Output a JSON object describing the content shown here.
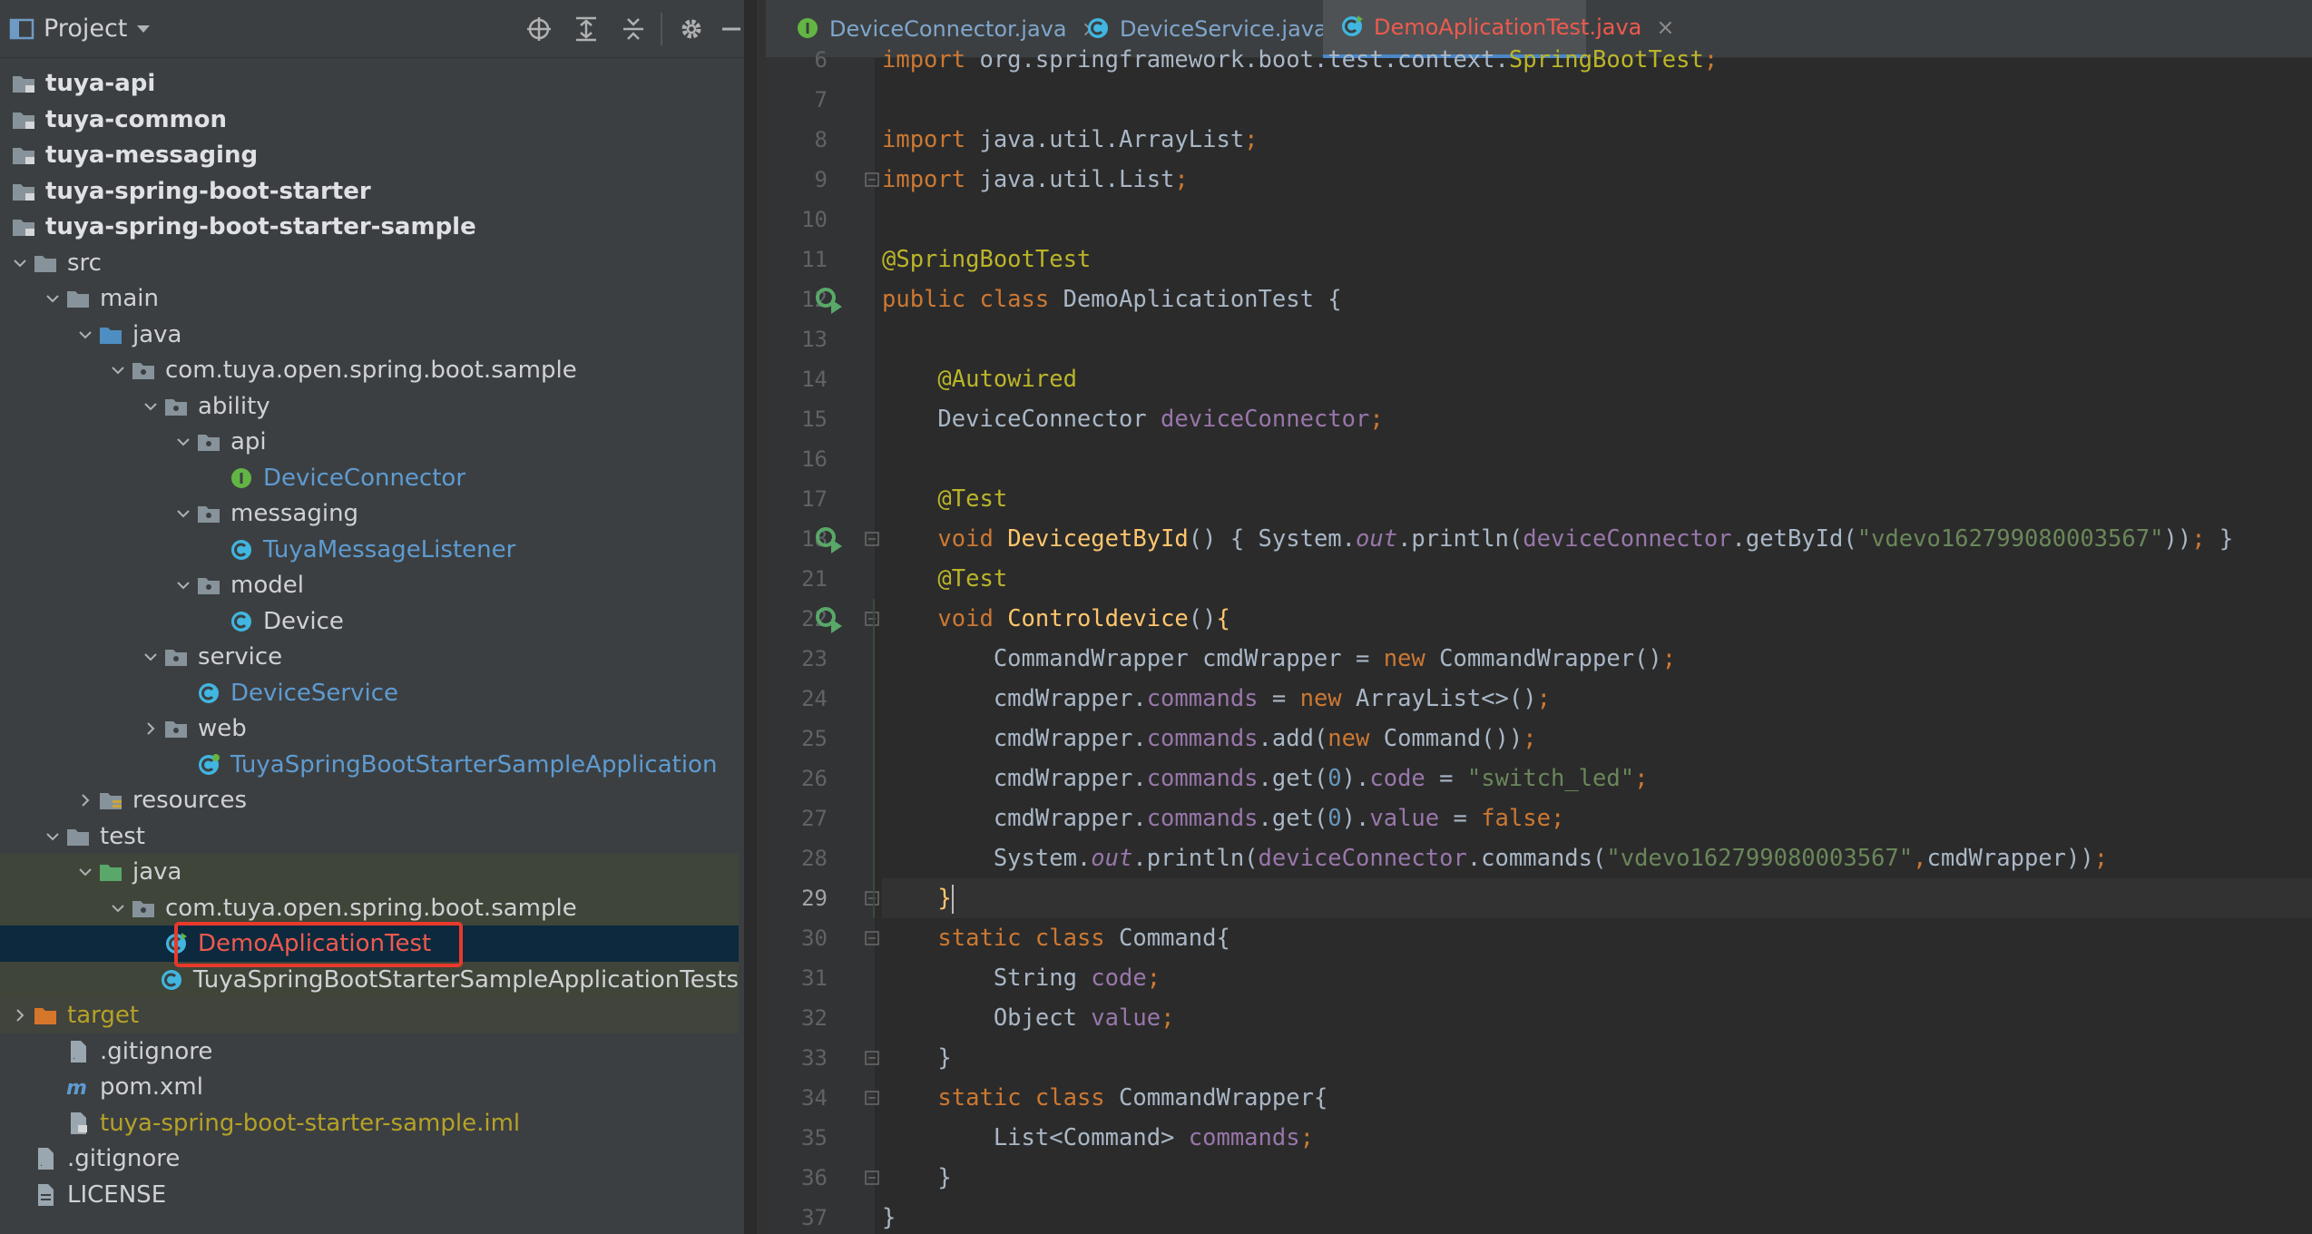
{
  "project_header": {
    "title": "Project",
    "icons": [
      "locate-icon",
      "expand-all-icon",
      "collapse-all-icon",
      "gear-icon",
      "hide-icon"
    ]
  },
  "tree": [
    {
      "label": "tuya-api",
      "icon": "module-folder-icon",
      "style": "bold",
      "expanded": null
    },
    {
      "label": "tuya-common",
      "icon": "module-folder-icon",
      "style": "bold",
      "expanded": null
    },
    {
      "label": "tuya-messaging",
      "icon": "module-folder-icon",
      "style": "bold",
      "expanded": null
    },
    {
      "label": "tuya-spring-boot-starter",
      "icon": "module-folder-icon",
      "style": "bold",
      "expanded": null
    },
    {
      "label": "tuya-spring-boot-starter-sample",
      "icon": "module-folder-icon",
      "style": "bold",
      "expanded": null
    },
    {
      "label": "src",
      "icon": "folder-icon",
      "style": "normal",
      "expanded": true
    },
    {
      "label": "main",
      "icon": "folder-icon",
      "style": "normal",
      "expanded": true
    },
    {
      "label": "java",
      "icon": "source-folder-icon",
      "style": "normal",
      "expanded": true
    },
    {
      "label": "com.tuya.open.spring.boot.sample",
      "icon": "package-icon",
      "style": "normal",
      "expanded": true
    },
    {
      "label": "ability",
      "icon": "package-icon",
      "style": "normal",
      "expanded": true
    },
    {
      "label": "api",
      "icon": "package-icon",
      "style": "normal",
      "expanded": true
    },
    {
      "label": "DeviceConnector",
      "icon": "interface-icon",
      "style": "blue",
      "expanded": null
    },
    {
      "label": "messaging",
      "icon": "package-icon",
      "style": "normal",
      "expanded": true
    },
    {
      "label": "TuyaMessageListener",
      "icon": "class-icon",
      "style": "blue",
      "expanded": null
    },
    {
      "label": "model",
      "icon": "package-icon",
      "style": "normal",
      "expanded": true
    },
    {
      "label": "Device",
      "icon": "class-icon",
      "style": "normal",
      "expanded": null
    },
    {
      "label": "service",
      "icon": "package-icon",
      "style": "normal",
      "expanded": true
    },
    {
      "label": "DeviceService",
      "icon": "class-icon",
      "style": "blue",
      "expanded": null
    },
    {
      "label": "web",
      "icon": "package-icon",
      "style": "normal",
      "expanded": false
    },
    {
      "label": "TuyaSpringBootStarterSampleApplication",
      "icon": "spring-class-icon",
      "style": "blue",
      "expanded": null
    },
    {
      "label": "resources",
      "icon": "resources-folder-icon",
      "style": "normal",
      "expanded": false
    },
    {
      "label": "test",
      "icon": "folder-icon",
      "style": "normal",
      "expanded": true
    },
    {
      "label": "java",
      "icon": "test-source-folder-icon",
      "style": "normal",
      "expanded": true
    },
    {
      "label": "com.tuya.open.spring.boot.sample",
      "icon": "package-icon",
      "style": "normal",
      "expanded": true
    },
    {
      "label": "DemoAplicationTest",
      "icon": "test-class-icon",
      "style": "red",
      "expanded": null
    },
    {
      "label": "TuyaSpringBootStarterSampleApplicationTests",
      "icon": "class-icon",
      "style": "normal",
      "expanded": null
    },
    {
      "label": "target",
      "icon": "excluded-folder-icon",
      "style": "olive",
      "expanded": false
    },
    {
      "label": ".gitignore",
      "icon": "file-icon",
      "style": "normal",
      "expanded": null
    },
    {
      "label": "pom.xml",
      "icon": "maven-icon",
      "style": "normal",
      "expanded": null
    },
    {
      "label": "tuya-spring-boot-starter-sample.iml",
      "icon": "iml-icon",
      "style": "olive",
      "expanded": null
    },
    {
      "label": ".gitignore",
      "icon": "file-icon",
      "style": "normal",
      "expanded": null
    },
    {
      "label": "LICENSE",
      "icon": "text-file-icon",
      "style": "normal",
      "expanded": null
    }
  ],
  "tabs": [
    {
      "label": "DeviceConnector.java",
      "icon": "interface-icon",
      "active": false
    },
    {
      "label": "DeviceService.java",
      "icon": "class-icon",
      "active": false
    },
    {
      "label": "DemoAplicationTest.java",
      "icon": "test-class-icon",
      "active": true
    }
  ],
  "tab_close_glyph": "×",
  "code_lines": [
    {
      "n": "6",
      "tokens": [
        [
          "kw",
          "import"
        ],
        [
          "dim",
          " org.springframework.boot.test.context."
        ],
        [
          "ann",
          "SpringBootTest"
        ],
        [
          "kw",
          ";"
        ]
      ]
    },
    {
      "n": "7",
      "tokens": []
    },
    {
      "n": "8",
      "tokens": [
        [
          "kw",
          "import"
        ],
        [
          "dim",
          " java.util.ArrayList"
        ],
        [
          "kw",
          ";"
        ]
      ]
    },
    {
      "n": "9",
      "tokens": [
        [
          "kw",
          "import"
        ],
        [
          "dim",
          " java.util.List"
        ],
        [
          "kw",
          ";"
        ]
      ]
    },
    {
      "n": "10",
      "tokens": []
    },
    {
      "n": "11",
      "tokens": [
        [
          "ann",
          "@SpringBootTest"
        ]
      ]
    },
    {
      "n": "12",
      "tokens": [
        [
          "kw",
          "public class "
        ],
        [
          "dim",
          "DemoAplicationTest {"
        ]
      ]
    },
    {
      "n": "13",
      "tokens": []
    },
    {
      "n": "14",
      "tokens": [
        [
          "dim",
          "    "
        ],
        [
          "ann",
          "@Autowired"
        ]
      ]
    },
    {
      "n": "15",
      "tokens": [
        [
          "dim",
          "    DeviceConnector "
        ],
        [
          "fld",
          "deviceConnector"
        ],
        [
          "kw",
          ";"
        ]
      ]
    },
    {
      "n": "16",
      "tokens": []
    },
    {
      "n": "17",
      "tokens": [
        [
          "dim",
          "    "
        ],
        [
          "ann",
          "@Test"
        ]
      ]
    },
    {
      "n": "18",
      "tokens": [
        [
          "dim",
          "    "
        ],
        [
          "kw",
          "void "
        ],
        [
          "fn",
          "DevicegetById"
        ],
        [
          "dim",
          "() { System."
        ],
        [
          "ital",
          "out"
        ],
        [
          "dim",
          ".println("
        ],
        [
          "fld",
          "deviceConnector"
        ],
        [
          "dim",
          ".getById("
        ],
        [
          "str",
          "\"vdevo162799080003567\""
        ],
        [
          "dim",
          "))"
        ],
        [
          "kw",
          ";"
        ],
        [
          "dim",
          " }"
        ]
      ]
    },
    {
      "n": "21",
      "tokens": [
        [
          "dim",
          "    "
        ],
        [
          "ann",
          "@Test"
        ]
      ]
    },
    {
      "n": "22",
      "tokens": [
        [
          "dim",
          "    "
        ],
        [
          "kw",
          "void "
        ],
        [
          "fn",
          "Controldevice"
        ],
        [
          "dim",
          "()"
        ],
        [
          "fn",
          "{"
        ]
      ]
    },
    {
      "n": "23",
      "tokens": [
        [
          "dim",
          "        CommandWrapper cmdWrapper = "
        ],
        [
          "kw",
          "new "
        ],
        [
          "dim",
          "CommandWrapper()"
        ],
        [
          "kw",
          ";"
        ]
      ]
    },
    {
      "n": "24",
      "tokens": [
        [
          "dim",
          "        cmdWrapper."
        ],
        [
          "fld",
          "commands"
        ],
        [
          "dim",
          " = "
        ],
        [
          "kw",
          "new "
        ],
        [
          "dim",
          "ArrayList<>()"
        ],
        [
          "kw",
          ";"
        ]
      ]
    },
    {
      "n": "25",
      "tokens": [
        [
          "dim",
          "        cmdWrapper."
        ],
        [
          "fld",
          "commands"
        ],
        [
          "dim",
          ".add("
        ],
        [
          "kw",
          "new "
        ],
        [
          "dim",
          "Command())"
        ],
        [
          "kw",
          ";"
        ]
      ]
    },
    {
      "n": "26",
      "tokens": [
        [
          "dim",
          "        cmdWrapper."
        ],
        [
          "fld",
          "commands"
        ],
        [
          "dim",
          ".get("
        ],
        [
          "num",
          "0"
        ],
        [
          "dim",
          ")."
        ],
        [
          "fld",
          "code"
        ],
        [
          "dim",
          " = "
        ],
        [
          "str",
          "\"switch_led\""
        ],
        [
          "kw",
          ";"
        ]
      ]
    },
    {
      "n": "27",
      "tokens": [
        [
          "dim",
          "        cmdWrapper."
        ],
        [
          "fld",
          "commands"
        ],
        [
          "dim",
          ".get("
        ],
        [
          "num",
          "0"
        ],
        [
          "dim",
          ")."
        ],
        [
          "fld",
          "value"
        ],
        [
          "dim",
          " = "
        ],
        [
          "kw",
          "false;"
        ]
      ]
    },
    {
      "n": "28",
      "tokens": [
        [
          "dim",
          "        System."
        ],
        [
          "ital",
          "out"
        ],
        [
          "dim",
          ".println("
        ],
        [
          "fld",
          "deviceConnector"
        ],
        [
          "dim",
          ".commands("
        ],
        [
          "str",
          "\"vdevo162799080003567\""
        ],
        [
          "kw",
          ","
        ],
        [
          "dim",
          "cmdWrapper))"
        ],
        [
          "kw",
          ";"
        ]
      ]
    },
    {
      "n": "29",
      "tokens": [
        [
          "dim",
          "    "
        ],
        [
          "fn",
          "}"
        ]
      ]
    },
    {
      "n": "30",
      "tokens": [
        [
          "dim",
          "    "
        ],
        [
          "kw",
          "static class "
        ],
        [
          "dim",
          "Command{"
        ]
      ]
    },
    {
      "n": "31",
      "tokens": [
        [
          "dim",
          "        String "
        ],
        [
          "fld",
          "code"
        ],
        [
          "kw",
          ";"
        ]
      ]
    },
    {
      "n": "32",
      "tokens": [
        [
          "dim",
          "        Object "
        ],
        [
          "fld",
          "value"
        ],
        [
          "kw",
          ";"
        ]
      ]
    },
    {
      "n": "33",
      "tokens": [
        [
          "dim",
          "    }"
        ]
      ]
    },
    {
      "n": "34",
      "tokens": [
        [
          "dim",
          "    "
        ],
        [
          "kw",
          "static class "
        ],
        [
          "dim",
          "CommandWrapper{"
        ]
      ]
    },
    {
      "n": "35",
      "tokens": [
        [
          "dim",
          "        List<Command> "
        ],
        [
          "fld",
          "commands"
        ],
        [
          "kw",
          ";"
        ]
      ]
    },
    {
      "n": "36",
      "tokens": [
        [
          "dim",
          "    }"
        ]
      ]
    },
    {
      "n": "37",
      "tokens": [
        [
          "dim",
          "}"
        ]
      ]
    }
  ],
  "current_line": "29",
  "colors": {
    "selection": "#0d293e",
    "highlight_box": "#e8392b",
    "active_tab_text": "#ee5a4e",
    "class_link": "#5e9bd1"
  }
}
